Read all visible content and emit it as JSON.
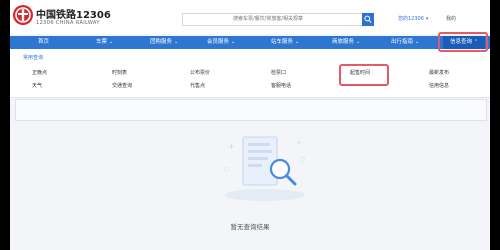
{
  "brand": {
    "title": "中国铁路12306",
    "subtitle": "12306 CHINA RAILWAY"
  },
  "search": {
    "placeholder": "搜索车票/餐饮/常旅客/相关规章"
  },
  "header": {
    "user_label": "您的12306",
    "my_label": "我的"
  },
  "nav": {
    "items": [
      {
        "label": "首页",
        "has_chevron": false
      },
      {
        "label": "车票",
        "has_chevron": true
      },
      {
        "label": "团购服务",
        "has_chevron": true
      },
      {
        "label": "会员服务",
        "has_chevron": true
      },
      {
        "label": "站车服务",
        "has_chevron": true
      },
      {
        "label": "商旅服务",
        "has_chevron": true
      },
      {
        "label": "出行指南",
        "has_chevron": true
      },
      {
        "label": "信息查询",
        "has_chevron": true
      }
    ],
    "active_index": 7
  },
  "dropdown": {
    "section_title": "常用查询",
    "rows": [
      [
        "正晚点",
        "时刻表",
        "公布票价",
        "检票口",
        "起售时间",
        "最新发布"
      ],
      [
        "天气",
        "交通查询",
        "代售点",
        "客服电话",
        "",
        "信用信息"
      ]
    ],
    "highlighted": "起售时间"
  },
  "empty_state": {
    "message": "暂无查询结果"
  },
  "colors": {
    "nav_blue": "#2d77d2",
    "brand_red": "#d9262c",
    "highlight": "#e45a6a"
  }
}
